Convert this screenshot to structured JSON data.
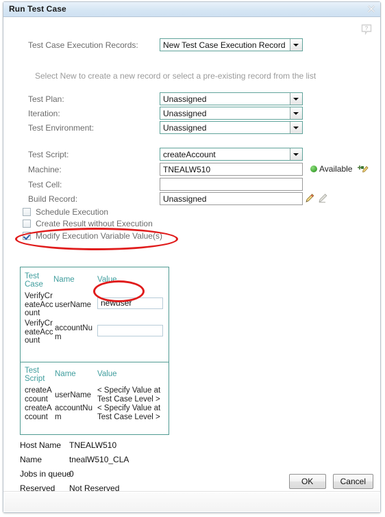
{
  "window": {
    "title": "Run Test Case",
    "close_icon": "close-icon",
    "help_icon": "help-question-icon"
  },
  "form": {
    "execution_records": {
      "label": "Test Case Execution Records:",
      "value": "New Test Case Execution Record",
      "hint": "Select New to create a new record or select a pre-existing record from the list"
    },
    "test_plan": {
      "label": "Test Plan:",
      "value": "Unassigned"
    },
    "iteration": {
      "label": "Iteration:",
      "value": "Unassigned"
    },
    "test_environment": {
      "label": "Test Environment:",
      "value": "Unassigned"
    },
    "test_script": {
      "label": "Test Script:",
      "value": "createAccount"
    },
    "machine": {
      "label": "Machine:",
      "value": "TNEALW510",
      "status": "Available",
      "status_color": "#4caf3f",
      "edit_icon": "machine-edit-icon"
    },
    "test_cell": {
      "label": "Test Cell:",
      "value": ""
    },
    "build_record": {
      "label": "Build Record:",
      "value": "Unassigned",
      "edit_icon": "pencil-edit-icon",
      "clear_icon": "pencil-gray-icon"
    }
  },
  "checkboxes": [
    {
      "label": "Schedule Execution",
      "checked": false
    },
    {
      "label": "Create Result without Execution",
      "checked": false
    },
    {
      "label": "Modify Execution Variable Value(s)",
      "checked": true
    }
  ],
  "variables": {
    "test_case_table": {
      "headers": [
        "Test Case",
        "Name",
        "Value"
      ],
      "rows": [
        {
          "scope": "VerifyCreateAccount",
          "name": "userName",
          "value": "newuser"
        },
        {
          "scope": "VerifyCreateAccount",
          "name": "accountNum",
          "value": ""
        }
      ]
    },
    "test_script_table": {
      "headers": [
        "Test Script",
        "Name",
        "Value"
      ],
      "rows": [
        {
          "scope": "createAccount",
          "name": "userName",
          "value": "< Specify Value at Test Case Level >"
        },
        {
          "scope": "createAccount",
          "name": "accountNum",
          "value": "< Specify Value at Test Case Level >"
        }
      ]
    }
  },
  "machine_info": [
    {
      "key": "Host Name",
      "value": "TNEALW510"
    },
    {
      "key": "Name",
      "value": "tnealW510_CLA"
    },
    {
      "key": "Jobs in queue",
      "value": "0"
    },
    {
      "key": "Reserved",
      "value": "Not Reserved"
    }
  ],
  "footer": {
    "ok_label": "OK",
    "cancel_label": "Cancel"
  },
  "annotations": {
    "color": "#e01b1b",
    "items": [
      "modify-execution-variable-checkbox",
      "username-value-input"
    ]
  }
}
